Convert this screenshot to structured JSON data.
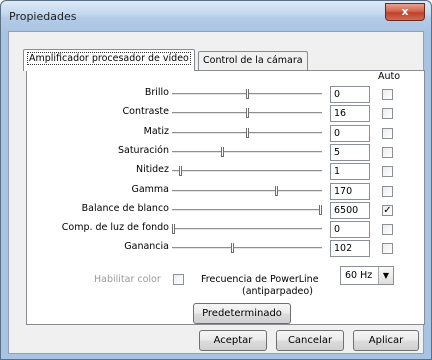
{
  "window": {
    "title": "Propiedades",
    "close_glyph": "x"
  },
  "tabs": [
    {
      "label": "Amplificador procesador de vídeo",
      "active": true
    },
    {
      "label": "Control de la cámara",
      "active": false
    }
  ],
  "auto_label": "Auto",
  "rows": [
    {
      "label": "Brillo",
      "value": "0",
      "level": 0.5,
      "auto": false
    },
    {
      "label": "Contraste",
      "value": "16",
      "level": 0.5,
      "auto": false
    },
    {
      "label": "Matiz",
      "value": "0",
      "level": 0.5,
      "auto": false
    },
    {
      "label": "Saturación",
      "value": "5",
      "level": 0.33,
      "auto": false
    },
    {
      "label": "Nitidez",
      "value": "1",
      "level": 0.05,
      "auto": false
    },
    {
      "label": "Gamma",
      "value": "170",
      "level": 0.7,
      "auto": false
    },
    {
      "label": "Balance de blanco",
      "value": "6500",
      "level": 1.0,
      "auto": true
    },
    {
      "label": "Comp. de luz de fondo",
      "value": "0",
      "level": 0.0,
      "auto": false
    },
    {
      "label": "Ganancia",
      "value": "102",
      "level": 0.4,
      "auto": false
    }
  ],
  "habilitar_color": "Habilitar color",
  "powerline": {
    "label": "Frecuencia de PowerLine",
    "sublabel": "(antiparpadeo)",
    "value": "60 Hz"
  },
  "buttons": {
    "default": "Predeterminado",
    "accept": "Aceptar",
    "cancel": "Cancelar",
    "apply": "Aplicar"
  },
  "colors": {
    "accent": "#aac5e3",
    "close": "#c0402a"
  }
}
